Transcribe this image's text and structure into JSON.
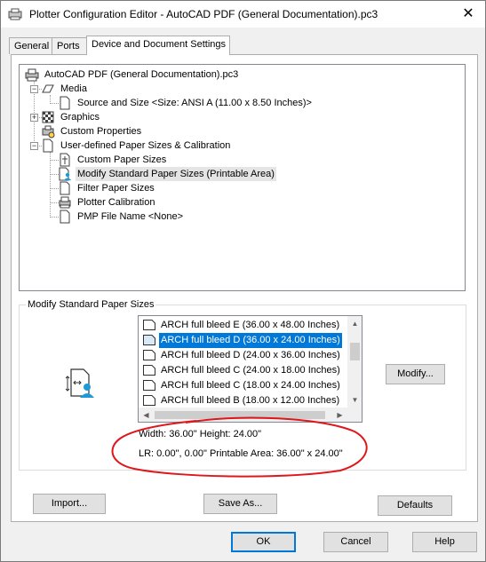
{
  "window": {
    "title": "Plotter Configuration Editor - AutoCAD PDF (General Documentation).pc3",
    "close_glyph": "✕"
  },
  "tabs": [
    {
      "label": "General"
    },
    {
      "label": "Ports"
    },
    {
      "label": "Device and Document Settings"
    }
  ],
  "tree": {
    "items": [
      {
        "label": "AutoCAD PDF (General Documentation).pc3",
        "icon": "plotter-icon"
      },
      {
        "label": "Media",
        "icon": "media-icon"
      },
      {
        "label": "Source and Size <Size: ANSI A (11.00 x 8.50 Inches)>",
        "icon": "page-icon"
      },
      {
        "label": "Graphics",
        "icon": "graphics-icon"
      },
      {
        "label": "Custom Properties",
        "icon": "custom-properties-icon"
      },
      {
        "label": "User-defined Paper Sizes & Calibration",
        "icon": "paper-icon"
      },
      {
        "label": "Custom Paper Sizes",
        "icon": "custom-paper-icon"
      },
      {
        "label": "Modify Standard Paper Sizes (Printable Area)",
        "icon": "modify-paper-icon"
      },
      {
        "label": "Filter Paper Sizes",
        "icon": "filter-paper-icon"
      },
      {
        "label": "Plotter Calibration",
        "icon": "calibration-icon"
      },
      {
        "label": "PMP File Name <None>",
        "icon": "pmp-file-icon"
      }
    ]
  },
  "modify_group": {
    "label": "Modify Standard Paper Sizes",
    "list": [
      {
        "label": "ARCH full bleed E (36.00 x 48.00 Inches)",
        "selected": false
      },
      {
        "label": "ARCH full bleed D (36.00 x 24.00 Inches)",
        "selected": true
      },
      {
        "label": "ARCH full bleed D (24.00 x 36.00 Inches)",
        "selected": false
      },
      {
        "label": "ARCH full bleed C (24.00 x 18.00 Inches)",
        "selected": false
      },
      {
        "label": "ARCH full bleed C (18.00 x 24.00 Inches)",
        "selected": false
      },
      {
        "label": "ARCH full bleed B (18.00 x 12.00 Inches)",
        "selected": false
      }
    ],
    "modify_label": "Modify...",
    "size_info": "Width: 36.00\" Height: 24.00\"",
    "area_info": "LR: 0.00\", 0.00\"  Printable Area: 36.00\" x 24.00\""
  },
  "panel_buttons": {
    "import": "Import...",
    "save_as": "Save As...",
    "defaults": "Defaults"
  },
  "dialog_buttons": {
    "ok": "OK",
    "cancel": "Cancel",
    "help": "Help"
  },
  "colors": {
    "selection": "#0078d7",
    "annotation": "#e0161b"
  }
}
